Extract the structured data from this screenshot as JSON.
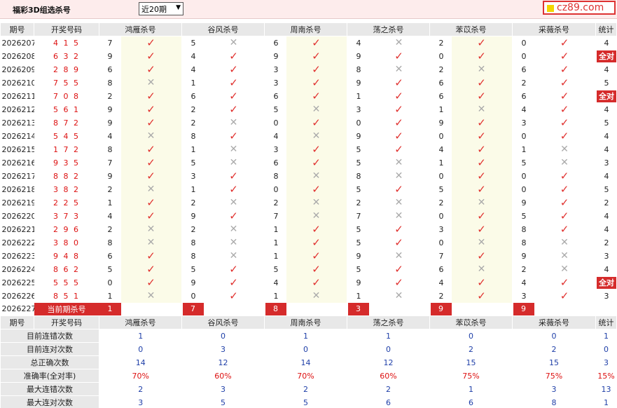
{
  "header": {
    "title": "福彩3D组选杀号",
    "period_select": "近20期",
    "logo": "cz89.com"
  },
  "columns": {
    "issue": "期号",
    "winner": "开奖号码",
    "methods": [
      "鸿雁杀号",
      "谷风杀号",
      "周南杀号",
      "荡之杀号",
      "苯苡杀号",
      "采薇杀号"
    ],
    "count": "统计"
  },
  "all_right_label": "全对",
  "rows": [
    {
      "issue": "2026207",
      "winner": "4 1 5",
      "kills": [
        [
          7,
          1
        ],
        [
          5,
          0
        ],
        [
          6,
          1
        ],
        [
          4,
          0
        ],
        [
          2,
          1
        ],
        [
          0,
          1
        ]
      ],
      "count": "4"
    },
    {
      "issue": "2026208",
      "winner": "6 3 2",
      "kills": [
        [
          9,
          1
        ],
        [
          4,
          1
        ],
        [
          9,
          1
        ],
        [
          9,
          1
        ],
        [
          0,
          1
        ],
        [
          0,
          1
        ]
      ],
      "count": "全对"
    },
    {
      "issue": "2026209",
      "winner": "2 8 9",
      "kills": [
        [
          6,
          1
        ],
        [
          4,
          1
        ],
        [
          3,
          1
        ],
        [
          8,
          0
        ],
        [
          2,
          0
        ],
        [
          6,
          1
        ]
      ],
      "count": "4"
    },
    {
      "issue": "2026210",
      "winner": "7 5 5",
      "kills": [
        [
          8,
          0
        ],
        [
          1,
          1
        ],
        [
          3,
          1
        ],
        [
          9,
          1
        ],
        [
          6,
          1
        ],
        [
          2,
          1
        ]
      ],
      "count": "5"
    },
    {
      "issue": "2026211",
      "winner": "7 0 8",
      "kills": [
        [
          2,
          1
        ],
        [
          6,
          1
        ],
        [
          6,
          1
        ],
        [
          1,
          1
        ],
        [
          6,
          1
        ],
        [
          6,
          1
        ]
      ],
      "count": "全对"
    },
    {
      "issue": "2026212",
      "winner": "5 6 1",
      "kills": [
        [
          9,
          1
        ],
        [
          2,
          1
        ],
        [
          5,
          0
        ],
        [
          3,
          1
        ],
        [
          1,
          0
        ],
        [
          4,
          1
        ]
      ],
      "count": "4"
    },
    {
      "issue": "2026213",
      "winner": "8 7 2",
      "kills": [
        [
          9,
          1
        ],
        [
          2,
          0
        ],
        [
          0,
          1
        ],
        [
          0,
          1
        ],
        [
          9,
          1
        ],
        [
          3,
          1
        ]
      ],
      "count": "5"
    },
    {
      "issue": "2026214",
      "winner": "5 4 5",
      "kills": [
        [
          4,
          0
        ],
        [
          8,
          1
        ],
        [
          4,
          0
        ],
        [
          9,
          1
        ],
        [
          0,
          1
        ],
        [
          0,
          1
        ]
      ],
      "count": "4"
    },
    {
      "issue": "2026215",
      "winner": "1 7 2",
      "kills": [
        [
          8,
          1
        ],
        [
          1,
          0
        ],
        [
          3,
          1
        ],
        [
          5,
          1
        ],
        [
          4,
          1
        ],
        [
          1,
          0
        ]
      ],
      "count": "4"
    },
    {
      "issue": "2026216",
      "winner": "9 3 5",
      "kills": [
        [
          7,
          1
        ],
        [
          5,
          0
        ],
        [
          6,
          1
        ],
        [
          5,
          0
        ],
        [
          1,
          1
        ],
        [
          5,
          0
        ]
      ],
      "count": "3"
    },
    {
      "issue": "2026217",
      "winner": "8 8 2",
      "kills": [
        [
          9,
          1
        ],
        [
          3,
          1
        ],
        [
          8,
          0
        ],
        [
          8,
          0
        ],
        [
          0,
          1
        ],
        [
          0,
          1
        ]
      ],
      "count": "4"
    },
    {
      "issue": "2026218",
      "winner": "3 8 2",
      "kills": [
        [
          2,
          0
        ],
        [
          1,
          1
        ],
        [
          0,
          1
        ],
        [
          5,
          1
        ],
        [
          5,
          1
        ],
        [
          0,
          1
        ]
      ],
      "count": "5"
    },
    {
      "issue": "2026219",
      "winner": "2 2 5",
      "kills": [
        [
          1,
          1
        ],
        [
          2,
          0
        ],
        [
          2,
          0
        ],
        [
          2,
          0
        ],
        [
          2,
          0
        ],
        [
          9,
          1
        ]
      ],
      "count": "2"
    },
    {
      "issue": "2026220",
      "winner": "3 7 3",
      "kills": [
        [
          4,
          1
        ],
        [
          9,
          1
        ],
        [
          7,
          0
        ],
        [
          7,
          0
        ],
        [
          0,
          1
        ],
        [
          5,
          1
        ]
      ],
      "count": "4"
    },
    {
      "issue": "2026221",
      "winner": "2 9 6",
      "kills": [
        [
          2,
          0
        ],
        [
          2,
          0
        ],
        [
          1,
          1
        ],
        [
          5,
          1
        ],
        [
          3,
          1
        ],
        [
          8,
          1
        ]
      ],
      "count": "4"
    },
    {
      "issue": "2026222",
      "winner": "3 8 0",
      "kills": [
        [
          8,
          0
        ],
        [
          8,
          0
        ],
        [
          1,
          1
        ],
        [
          5,
          1
        ],
        [
          0,
          0
        ],
        [
          8,
          0
        ]
      ],
      "count": "2"
    },
    {
      "issue": "2026223",
      "winner": "9 4 8",
      "kills": [
        [
          6,
          1
        ],
        [
          8,
          0
        ],
        [
          1,
          1
        ],
        [
          9,
          0
        ],
        [
          7,
          1
        ],
        [
          9,
          0
        ]
      ],
      "count": "3"
    },
    {
      "issue": "2026224",
      "winner": "8 6 2",
      "kills": [
        [
          5,
          1
        ],
        [
          5,
          1
        ],
        [
          5,
          1
        ],
        [
          5,
          1
        ],
        [
          6,
          0
        ],
        [
          2,
          0
        ]
      ],
      "count": "4"
    },
    {
      "issue": "2026225",
      "winner": "5 5 5",
      "kills": [
        [
          0,
          1
        ],
        [
          9,
          1
        ],
        [
          4,
          1
        ],
        [
          9,
          1
        ],
        [
          4,
          1
        ],
        [
          4,
          1
        ]
      ],
      "count": "全对"
    },
    {
      "issue": "2026226",
      "winner": "8 5 1",
      "kills": [
        [
          1,
          0
        ],
        [
          0,
          1
        ],
        [
          1,
          0
        ],
        [
          1,
          0
        ],
        [
          2,
          1
        ],
        [
          3,
          1
        ]
      ],
      "count": "3"
    }
  ],
  "current": {
    "issue": "2026227",
    "label": "当前期杀号",
    "kills": [
      "1",
      "7",
      "8",
      "3",
      "9",
      "9"
    ]
  },
  "stats_header": {
    "issue": "期号",
    "winner": "开奖号码"
  },
  "stats": [
    {
      "label": "目前连错次数",
      "values": [
        "1",
        "0",
        "1",
        "1",
        "0",
        "0"
      ],
      "count": "1",
      "red": false
    },
    {
      "label": "目前连对次数",
      "values": [
        "0",
        "3",
        "0",
        "0",
        "2",
        "2"
      ],
      "count": "0",
      "red": false
    },
    {
      "label": "总正确次数",
      "values": [
        "14",
        "12",
        "14",
        "12",
        "15",
        "15"
      ],
      "count": "3",
      "red": false
    },
    {
      "label": "准确率(全对率)",
      "values": [
        "70%",
        "60%",
        "70%",
        "60%",
        "75%",
        "75%"
      ],
      "count": "15%",
      "red": true
    },
    {
      "label": "最大连错次数",
      "values": [
        "2",
        "3",
        "2",
        "2",
        "1",
        "3"
      ],
      "count": "13",
      "red": false
    },
    {
      "label": "最大连对次数",
      "values": [
        "3",
        "5",
        "5",
        "6",
        "6",
        "8"
      ],
      "count": "1",
      "red": false
    }
  ],
  "colors": {
    "accent_red": "#d52b2b",
    "stat_blue": "#1f3fa8",
    "header_gray": "#e8e8e8"
  }
}
